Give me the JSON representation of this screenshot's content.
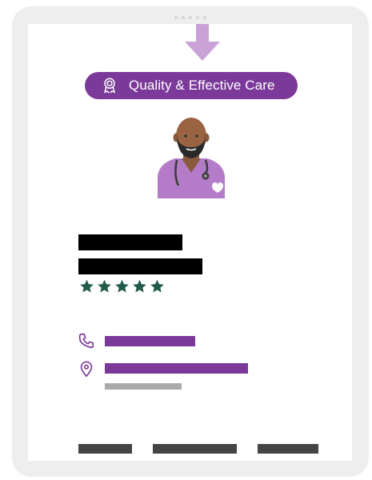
{
  "badge": {
    "label": "Quality & Effective Care",
    "icon": "award-ribbon-icon",
    "color": "#7b3a99"
  },
  "arrow": {
    "icon": "down-arrow-icon",
    "color": "#c9a3d8"
  },
  "provider": {
    "avatar": "doctor-avatar",
    "rating": {
      "stars": 5,
      "max": 5,
      "color": "#1f5a4a"
    }
  },
  "contact": {
    "phone_icon": "phone-icon",
    "location_icon": "location-pin-icon",
    "accent": "#7b3a99",
    "secondary": "#aaaaaa"
  },
  "colors": {
    "frame": "#eeeeee",
    "redaction": "#000000",
    "footer_button": "#444444"
  }
}
